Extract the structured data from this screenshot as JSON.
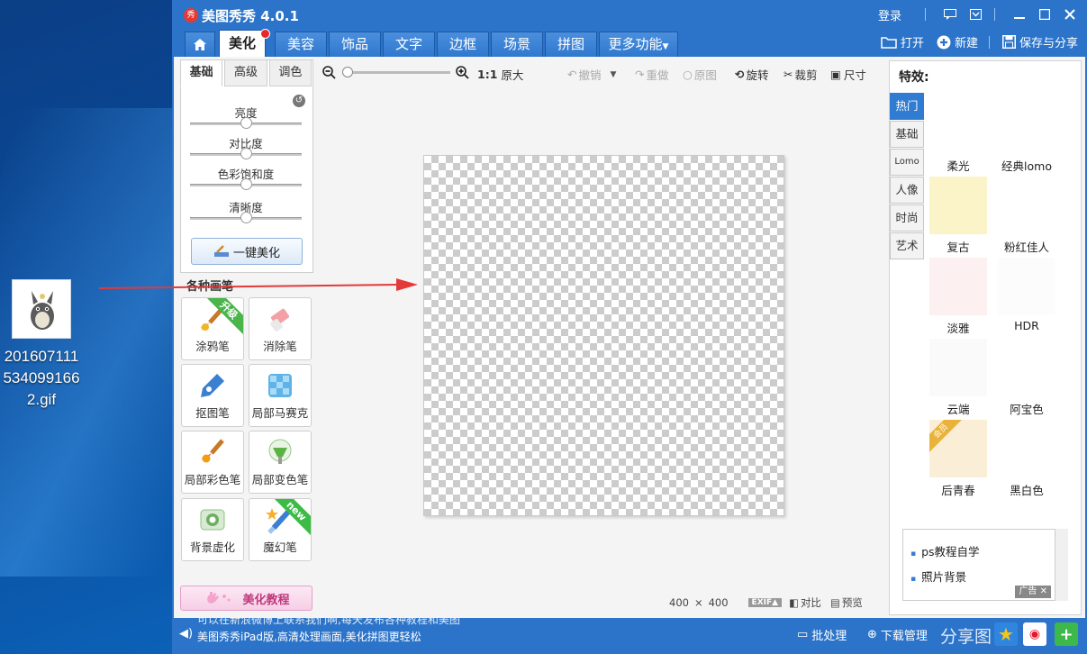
{
  "desktop": {
    "icon_label": "201607111\n534099166\n2.gif"
  },
  "app": {
    "title": "美图秀秀 4.0.1",
    "login": "登录",
    "colors": {
      "primary": "#2c74c9",
      "active_tab": "#ffffff",
      "accent_red": "#e8262b"
    },
    "tabs": [
      "美化",
      "美容",
      "饰品",
      "文字",
      "边框",
      "场景",
      "拼图",
      "更多功能"
    ],
    "actions": {
      "open": "打开",
      "new": "新建",
      "save_share": "保存与分享"
    }
  },
  "adjust": {
    "tabs": [
      "基础",
      "高级",
      "调色"
    ],
    "sliders": [
      {
        "label": "亮度",
        "value": 0.5
      },
      {
        "label": "对比度",
        "value": 0.5
      },
      {
        "label": "色彩饱和度",
        "value": 0.5
      },
      {
        "label": "清晰度",
        "value": 0.5
      }
    ],
    "one_click": "一键美化"
  },
  "brushes": {
    "title": "各种画笔",
    "items": [
      {
        "label": "涂鸦笔",
        "ribbon": "升级"
      },
      {
        "label": "消除笔",
        "ribbon": ""
      },
      {
        "label": "抠图笔",
        "ribbon": ""
      },
      {
        "label": "局部马赛克",
        "ribbon": ""
      },
      {
        "label": "局部彩色笔",
        "ribbon": ""
      },
      {
        "label": "局部变色笔",
        "ribbon": ""
      },
      {
        "label": "背景虚化",
        "ribbon": ""
      },
      {
        "label": "魔幻笔",
        "ribbon": "new"
      }
    ],
    "tutorial": "美化教程"
  },
  "toolbar": {
    "ratio": "1:1",
    "original_size": "原大",
    "undo": "撤销",
    "redo": "重做",
    "original": "原图",
    "rotate": "旋转",
    "crop": "裁剪",
    "size": "尺寸"
  },
  "canvas": {
    "width": "400",
    "height": "400",
    "times": "×",
    "exif": "EXIF▲",
    "compare": "对比",
    "preview": "预览"
  },
  "effects": {
    "title": "特效:",
    "categories": [
      "热门",
      "基础",
      "Lomo",
      "人像",
      "时尚",
      "艺术"
    ],
    "items": [
      {
        "label": "柔光",
        "color": "#ffffff",
        "badge": ""
      },
      {
        "label": "经典lomo",
        "color": "#ffffff",
        "badge": ""
      },
      {
        "label": "复古",
        "color": "#fbf4c8",
        "badge": ""
      },
      {
        "label": "粉红佳人",
        "color": "#ffffff",
        "badge": ""
      },
      {
        "label": "淡雅",
        "color": "#fdf0f0",
        "badge": ""
      },
      {
        "label": "HDR",
        "color": "#fcfcfc",
        "badge": ""
      },
      {
        "label": "云端",
        "color": "#fafafa",
        "badge": ""
      },
      {
        "label": "阿宝色",
        "color": "#ffffff",
        "badge": ""
      },
      {
        "label": "后青春",
        "color": "#fbeed6",
        "badge": "会员"
      },
      {
        "label": "黑白色",
        "color": "#ffffff",
        "badge": ""
      }
    ],
    "ads": [
      "ps教程自学",
      "照片背景"
    ],
    "ad_tag": "广告"
  },
  "bottom": {
    "ticker": [
      "可以在新浪微博上联系我们啊,每天发布各种教程和美图",
      "美图秀秀iPad版,高清处理画面,美化拼图更轻松"
    ],
    "batch": "批处理",
    "download": "下载管理",
    "share": "分享图"
  }
}
